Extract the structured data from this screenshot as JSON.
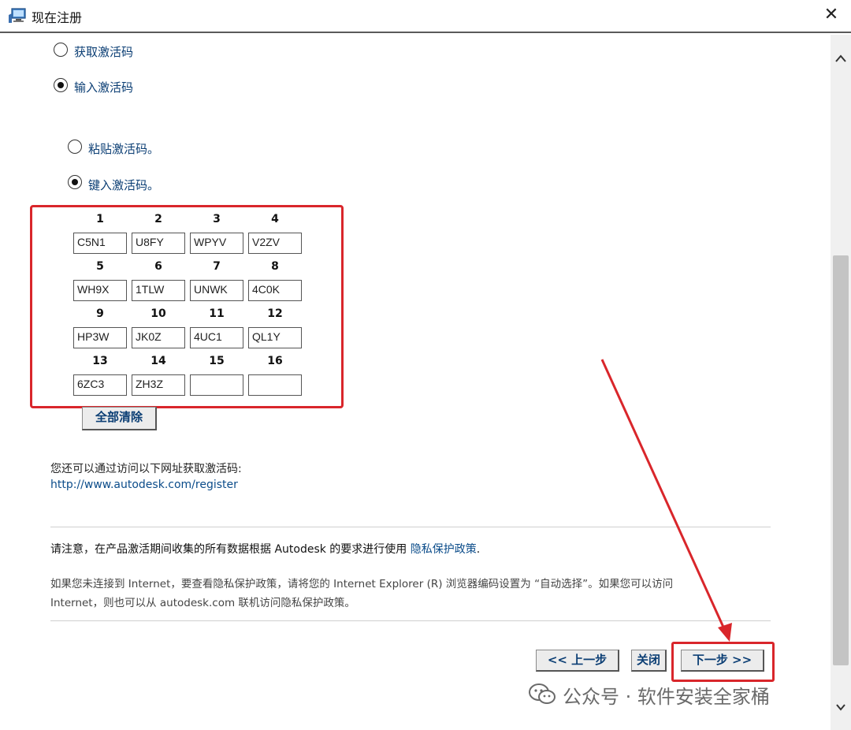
{
  "window": {
    "title": "现在注册",
    "close_glyph": "✕"
  },
  "options": {
    "get_code": "获取激活码",
    "enter_code": "输入激活码",
    "paste_code": "粘贴激活码。",
    "type_code": "键入激活码。"
  },
  "code_grid": {
    "cells": [
      {
        "num": "1",
        "value": "C5N1"
      },
      {
        "num": "2",
        "value": "U8FY"
      },
      {
        "num": "3",
        "value": "WPYV"
      },
      {
        "num": "4",
        "value": "V2ZV"
      },
      {
        "num": "5",
        "value": "WH9X"
      },
      {
        "num": "6",
        "value": "1TLW"
      },
      {
        "num": "7",
        "value": "UNWK"
      },
      {
        "num": "8",
        "value": "4C0K"
      },
      {
        "num": "9",
        "value": "HP3W"
      },
      {
        "num": "10",
        "value": "JK0Z"
      },
      {
        "num": "11",
        "value": "4UC1"
      },
      {
        "num": "12",
        "value": "QL1Y"
      },
      {
        "num": "13",
        "value": "6ZC3"
      },
      {
        "num": "14",
        "value": "ZH3Z"
      },
      {
        "num": "15",
        "value": ""
      },
      {
        "num": "16",
        "value": ""
      }
    ]
  },
  "clear_all_label": "全部清除",
  "alt_text": "您还可以通过访问以下网址获取激活码:",
  "register_url": "http://www.autodesk.com/register",
  "notice": {
    "text": "请注意，在产品激活期间收集的所有数据根据 Autodesk 的要求进行使用 ",
    "link": "隐私保护政策",
    "end": "."
  },
  "internet_note_line1": "如果您未连接到 Internet，要查看隐私保护政策，请将您的 Internet Explorer (R) 浏览器编码设置为 “自动选择”。如果您可以访问",
  "internet_note_line2": "Internet，则也可以从 autodesk.com 联机访问隐私保护政策。",
  "buttons": {
    "back": "<< 上一步",
    "close": "关闭",
    "next": "下一步 >>"
  },
  "watermark": "公众号 · 软件安装全家桶",
  "colors": {
    "highlight": "#d9262b",
    "link": "#0b4c8a"
  }
}
